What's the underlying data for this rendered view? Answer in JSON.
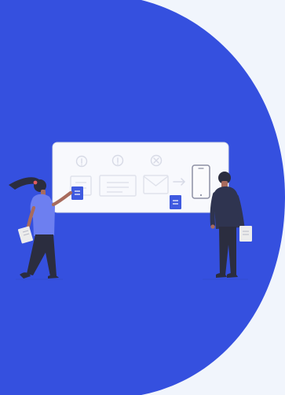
{
  "hero": {
    "colors": {
      "page_background": "#f1f5fc",
      "accent_blue": "#3550df",
      "panel_white": "#f8f9fd",
      "panel_line": "#d8dbe6",
      "dark_navy": "#2f3450",
      "note_blue": "#3f5ae0",
      "skin": "#a86b5d",
      "hair_dark": "#2b2d3f",
      "hair_tie": "#e35b61",
      "shirt_blue": "#6d7ff0",
      "paper": "#ececec"
    },
    "illustration": {
      "panel_icons": [
        "info-icon",
        "info-icon",
        "close-icon"
      ],
      "process_arrow": "arrow-right-icon",
      "phone": "phone-icon"
    }
  }
}
